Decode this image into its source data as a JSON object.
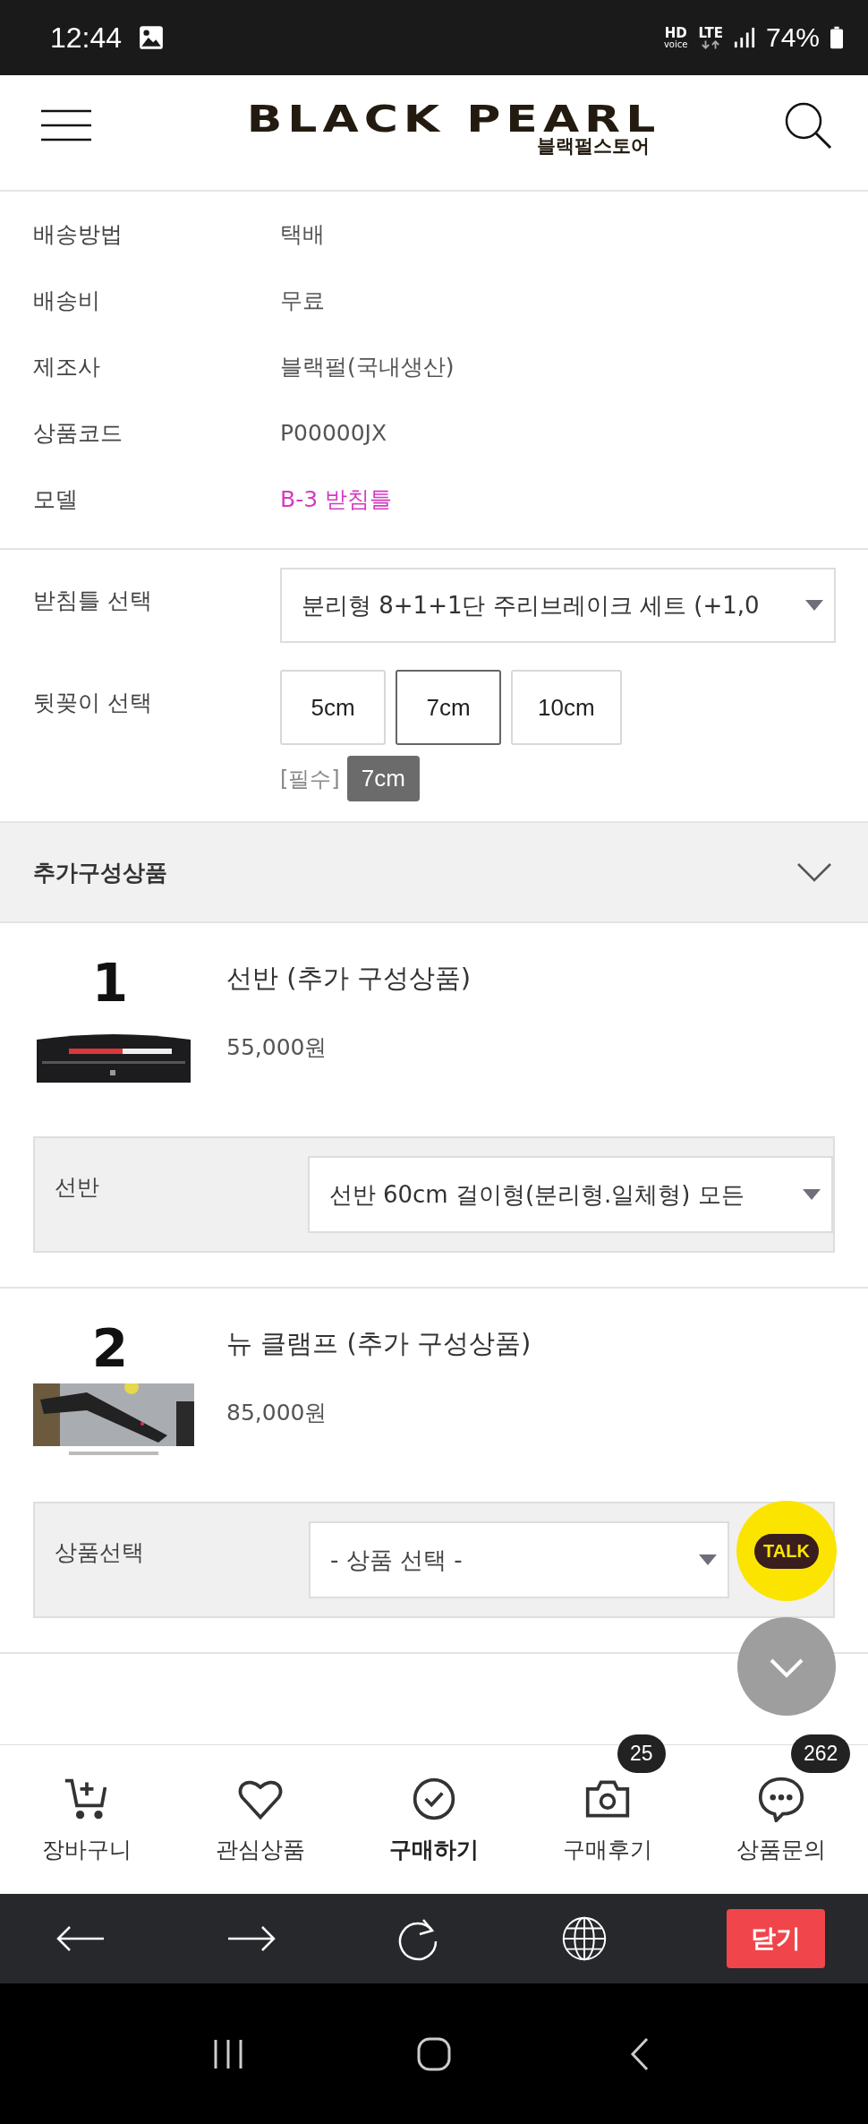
{
  "status_bar": {
    "time": "12:44",
    "hd": "HD",
    "voice": "voice",
    "network": "LTE",
    "battery": "74%"
  },
  "header": {
    "logo": "BLACK PEARL",
    "logo_sub": "블랙펄스토어"
  },
  "info": [
    {
      "label": "배송방법",
      "value": "택배",
      "kind": "plain"
    },
    {
      "label": "배송비",
      "value": "무료",
      "kind": "plain"
    },
    {
      "label": "제조사",
      "value": "블랙펄(국내생산)",
      "kind": "plain"
    },
    {
      "label": "상품코드",
      "value": "P00000JX",
      "kind": "plain"
    },
    {
      "label": "모델",
      "value": "B-3 받침틀",
      "kind": "link"
    }
  ],
  "options": {
    "stand": {
      "label": "받침틀 선택",
      "value": "분리형 8+1+1단 주리브레이크 세트 (+1,0"
    },
    "rear": {
      "label": "뒷꽂이 선택",
      "choices": [
        {
          "label": "5cm",
          "selected": false
        },
        {
          "label": "7cm",
          "selected": true
        },
        {
          "label": "10cm",
          "selected": false
        }
      ],
      "required": "[필수]",
      "chosen": "7cm"
    }
  },
  "addons": {
    "title": "추가구성상품",
    "expanded": true,
    "items": [
      {
        "number": "1",
        "name": "선반 (추가 구성상품)",
        "price": "55,000원",
        "option_label": "선반",
        "option_value": "선반 60cm 걸이형(분리형.일체형) 모든",
        "placeholder": false
      },
      {
        "number": "2",
        "name": "뉴 클램프 (추가 구성상품)",
        "price": "85,000원",
        "option_label": "상품선택",
        "option_value": "- 상품 선택 -",
        "placeholder": true
      }
    ]
  },
  "floating": {
    "talk": "TALK"
  },
  "bottom_nav": [
    {
      "label": "장바구니",
      "kind": "cart",
      "selected": false
    },
    {
      "label": "관심상품",
      "kind": "heart",
      "selected": false
    },
    {
      "label": "구매하기",
      "kind": "check",
      "selected": true
    },
    {
      "label": "구매후기",
      "kind": "camera",
      "selected": false,
      "badge": "25"
    },
    {
      "label": "상품문의",
      "kind": "chat",
      "selected": false,
      "badge": "262"
    }
  ],
  "browser_bar": {
    "close": "닫기"
  }
}
